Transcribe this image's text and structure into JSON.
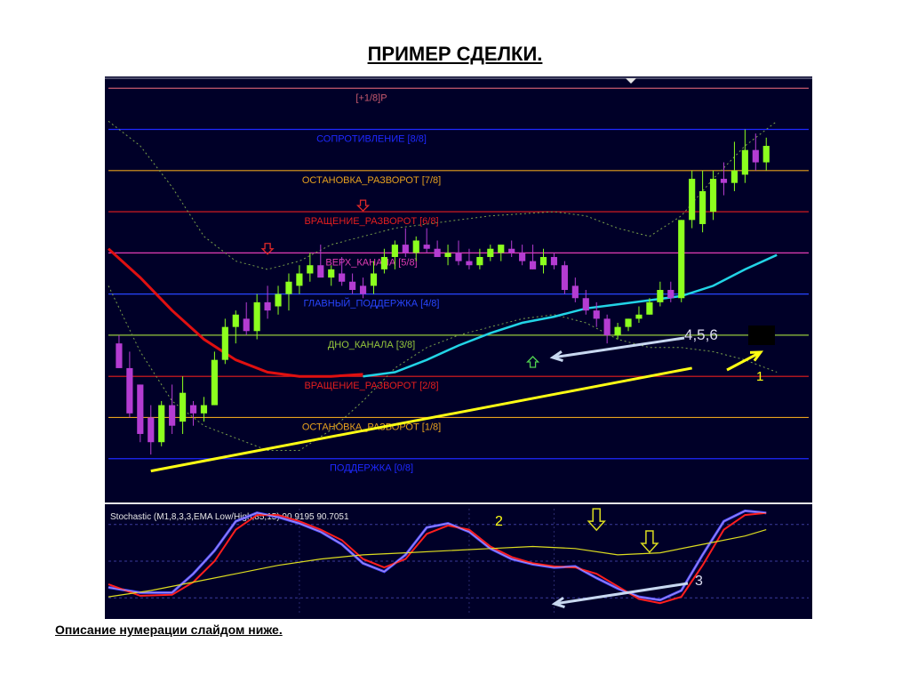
{
  "page": {
    "title": "ПРИМЕР СДЕЛКИ.",
    "footer_note": "Описание нумерации слайдом ниже."
  },
  "colors": {
    "background": "#000028",
    "bull_candle": "#8cff1e",
    "bear_candle": "#b43cd2",
    "ma_slow": "#e01010",
    "ma_fast": "#22d4e6",
    "channel": "#7aa04a",
    "trend_line": "#ffff14",
    "annotation_arrow": "#c8d8f0",
    "stoch_main": "#4a4aff",
    "stoch_signal": "#ff1e1e",
    "stoch_slow": "#dcdc20"
  },
  "chart_data": [
    {
      "type": "candlestick",
      "x": {
        "min": 0,
        "max": 66
      },
      "y": {
        "min": -1.0,
        "max": 9.2
      },
      "levels": [
        {
          "value": 9,
          "label": "[+1/8]P",
          "color": "#c85a6e"
        },
        {
          "value": 8,
          "label": "СОПРОТИВЛЕНИЕ [8/8]",
          "color": "#1e28ff"
        },
        {
          "value": 7,
          "label": "ОСТАНОВКА_РАЗВОРОТ [7/8]",
          "color": "#e6a01e"
        },
        {
          "value": 6,
          "label": "ВРАЩЕНИЕ_РАЗВОРОТ [6/8]",
          "color": "#e61e1e"
        },
        {
          "value": 5,
          "label": "ВЕРХ_КАНАЛА [5/8]",
          "color": "#e23cb4"
        },
        {
          "value": 4,
          "label": "ГЛАВНЫЙ_ПОДДЕРЖКА [4/8]",
          "color": "#2846ff"
        },
        {
          "value": 3,
          "label": "ДНО_КАНАЛА [3/8]",
          "color": "#96c83c"
        },
        {
          "value": 2,
          "label": "ВРАЩЕНИЕ_РАЗВОРОТ [2/8]",
          "color": "#e61e1e"
        },
        {
          "value": 1,
          "label": "ОСТАНОВКА_РАЗВОРОТ [1/8]",
          "color": "#e6a01e"
        },
        {
          "value": 0,
          "label": "ПОДДЕРЖКА [0/8]",
          "color": "#1e28ff"
        }
      ],
      "candles": [
        [
          1,
          2.8,
          3.0,
          2.2,
          2.2
        ],
        [
          2,
          2.2,
          2.6,
          1.0,
          1.1
        ],
        [
          3,
          1.8,
          1.8,
          0.4,
          0.6
        ],
        [
          4,
          1.0,
          1.3,
          0.1,
          0.4
        ],
        [
          5,
          0.4,
          1.4,
          0.3,
          1.3
        ],
        [
          6,
          1.3,
          1.8,
          0.6,
          0.8
        ],
        [
          7,
          0.9,
          2.0,
          0.6,
          1.6
        ],
        [
          8,
          1.3,
          1.4,
          0.8,
          1.1
        ],
        [
          9,
          1.1,
          1.5,
          0.9,
          1.3
        ],
        [
          10,
          1.3,
          2.6,
          1.3,
          2.4
        ],
        [
          11,
          2.4,
          3.4,
          2.3,
          3.2
        ],
        [
          12,
          3.2,
          3.6,
          2.8,
          3.5
        ],
        [
          13,
          3.4,
          3.8,
          3.0,
          3.1
        ],
        [
          14,
          3.1,
          4.0,
          2.9,
          3.8
        ],
        [
          15,
          3.8,
          4.2,
          3.4,
          3.6
        ],
        [
          16,
          3.7,
          4.2,
          3.5,
          4.0
        ],
        [
          17,
          4.0,
          4.5,
          3.6,
          4.3
        ],
        [
          18,
          4.2,
          4.7,
          4.0,
          4.5
        ],
        [
          19,
          4.5,
          5.0,
          4.3,
          4.7
        ],
        [
          20,
          4.7,
          5.2,
          4.5,
          4.4
        ],
        [
          21,
          4.4,
          4.7,
          4.2,
          4.6
        ],
        [
          22,
          4.5,
          4.9,
          4.2,
          4.3
        ],
        [
          23,
          4.3,
          4.5,
          4.0,
          4.1
        ],
        [
          24,
          4.2,
          4.4,
          3.9,
          4.0
        ],
        [
          25,
          4.2,
          4.8,
          4.0,
          4.5
        ],
        [
          26,
          4.6,
          5.1,
          4.5,
          4.9
        ],
        [
          27,
          4.9,
          5.3,
          4.6,
          5.2
        ],
        [
          28,
          5.2,
          5.6,
          4.9,
          5.0
        ],
        [
          29,
          5.0,
          5.4,
          4.8,
          5.3
        ],
        [
          30,
          5.2,
          5.6,
          5.0,
          5.1
        ],
        [
          31,
          5.1,
          5.3,
          4.9,
          4.9
        ],
        [
          32,
          4.9,
          5.2,
          4.7,
          5.0
        ],
        [
          33,
          5.0,
          5.3,
          4.7,
          4.8
        ],
        [
          34,
          4.8,
          5.1,
          4.6,
          4.7
        ],
        [
          35,
          4.7,
          5.1,
          4.6,
          4.9
        ],
        [
          36,
          4.9,
          5.2,
          4.8,
          5.1
        ],
        [
          37,
          5.0,
          5.2,
          4.8,
          5.2
        ],
        [
          38,
          5.1,
          5.3,
          4.9,
          5.0
        ],
        [
          39,
          5.0,
          5.2,
          4.7,
          4.8
        ],
        [
          40,
          4.8,
          5.2,
          4.6,
          4.6
        ],
        [
          41,
          4.7,
          5.1,
          4.5,
          4.9
        ],
        [
          42,
          4.9,
          5.0,
          4.6,
          4.7
        ],
        [
          43,
          4.7,
          4.8,
          4.0,
          4.1
        ],
        [
          44,
          4.2,
          4.4,
          3.8,
          3.9
        ],
        [
          45,
          3.9,
          4.1,
          3.5,
          3.6
        ],
        [
          46,
          3.6,
          3.8,
          3.2,
          3.4
        ],
        [
          47,
          3.4,
          3.5,
          2.8,
          3.0
        ],
        [
          48,
          3.0,
          3.3,
          2.9,
          3.2
        ],
        [
          49,
          3.2,
          3.4,
          3.1,
          3.4
        ],
        [
          50,
          3.4,
          3.7,
          3.3,
          3.5
        ],
        [
          51,
          3.5,
          3.9,
          3.5,
          3.8
        ],
        [
          52,
          3.8,
          4.3,
          3.7,
          4.1
        ],
        [
          53,
          4.1,
          4.3,
          3.8,
          3.9
        ],
        [
          54,
          3.9,
          5.8,
          3.8,
          5.8
        ],
        [
          55,
          5.8,
          7.0,
          5.6,
          6.8
        ],
        [
          56,
          5.7,
          7.0,
          5.5,
          6.5
        ],
        [
          57,
          6.0,
          7.0,
          5.8,
          6.8
        ],
        [
          58,
          6.8,
          7.2,
          6.4,
          6.7
        ],
        [
          59,
          6.7,
          7.7,
          6.5,
          7.0
        ],
        [
          60,
          6.9,
          8.0,
          6.7,
          7.5
        ],
        [
          61,
          7.5,
          7.9,
          7.0,
          7.2
        ],
        [
          62,
          7.2,
          7.8,
          7.0,
          7.6
        ]
      ],
      "ma_slow": [
        [
          0,
          5.1
        ],
        [
          3,
          4.4
        ],
        [
          6,
          3.6
        ],
        [
          9,
          2.9
        ],
        [
          12,
          2.4
        ],
        [
          15,
          2.1
        ],
        [
          18,
          2.0
        ],
        [
          21,
          2.0
        ],
        [
          24,
          2.05
        ]
      ],
      "ma_fast": [
        [
          24,
          2.0
        ],
        [
          27,
          2.1
        ],
        [
          30,
          2.4
        ],
        [
          33,
          2.75
        ],
        [
          36,
          3.05
        ],
        [
          39,
          3.3
        ],
        [
          42,
          3.45
        ],
        [
          45,
          3.65
        ],
        [
          48,
          3.75
        ],
        [
          51,
          3.85
        ],
        [
          54,
          3.95
        ],
        [
          57,
          4.2
        ],
        [
          60,
          4.6
        ],
        [
          63,
          4.95
        ]
      ],
      "channel_upper": [
        [
          0,
          8.2
        ],
        [
          3,
          7.6
        ],
        [
          6,
          6.6
        ],
        [
          9,
          5.4
        ],
        [
          12,
          4.8
        ],
        [
          15,
          4.6
        ],
        [
          18,
          4.8
        ],
        [
          21,
          5.2
        ],
        [
          24,
          5.4
        ],
        [
          27,
          5.6
        ],
        [
          30,
          5.7
        ],
        [
          33,
          5.8
        ],
        [
          36,
          5.9
        ],
        [
          39,
          5.95
        ],
        [
          42,
          6.0
        ],
        [
          45,
          5.9
        ],
        [
          48,
          5.6
        ],
        [
          51,
          5.4
        ],
        [
          54,
          5.9
        ],
        [
          57,
          6.8
        ],
        [
          60,
          7.6
        ],
        [
          63,
          8.2
        ]
      ],
      "channel_lower": [
        [
          0,
          4.2
        ],
        [
          3,
          2.6
        ],
        [
          6,
          1.4
        ],
        [
          9,
          0.8
        ],
        [
          12,
          0.5
        ],
        [
          15,
          0.2
        ],
        [
          18,
          0.2
        ],
        [
          21,
          0.7
        ],
        [
          24,
          1.4
        ],
        [
          27,
          2.2
        ],
        [
          30,
          2.7
        ],
        [
          33,
          3.0
        ],
        [
          36,
          3.2
        ],
        [
          39,
          3.4
        ],
        [
          42,
          3.5
        ],
        [
          45,
          3.3
        ],
        [
          48,
          2.9
        ],
        [
          51,
          2.7
        ],
        [
          54,
          2.7
        ],
        [
          57,
          2.6
        ],
        [
          60,
          2.4
        ],
        [
          63,
          2.1
        ]
      ],
      "trend_line": {
        "from": [
          4,
          -0.3
        ],
        "to": [
          55,
          2.2
        ]
      },
      "signal_arrows": [
        {
          "x": 15,
          "y": 5.1,
          "dir": "down",
          "color": "#e02828"
        },
        {
          "x": 24,
          "y": 6.15,
          "dir": "down",
          "color": "#e02828"
        },
        {
          "x": 40,
          "y": 2.35,
          "dir": "up",
          "color": "#50d250"
        }
      ],
      "annotations": [
        {
          "text": "4,5,6",
          "color": "#dcdcf0"
        },
        {
          "text": "1",
          "color": "#ffff14"
        }
      ]
    },
    {
      "type": "line",
      "title": "Stochastic (M1,8,3,3,EMA Low/High,85,15) 90.9195 90.7051",
      "y": {
        "min": 0,
        "max": 100
      },
      "levels": [
        85,
        50,
        15
      ],
      "series": [
        {
          "values": [
            [
              0,
              25
            ],
            [
              3,
              20
            ],
            [
              6,
              20
            ],
            [
              8,
              38
            ],
            [
              10,
              60
            ],
            [
              12,
              88
            ],
            [
              14,
              96
            ],
            [
              16,
              92
            ],
            [
              18,
              86
            ],
            [
              20,
              78
            ],
            [
              22,
              66
            ],
            [
              24,
              48
            ],
            [
              26,
              40
            ],
            [
              28,
              56
            ],
            [
              30,
              82
            ],
            [
              32,
              86
            ],
            [
              34,
              78
            ],
            [
              36,
              62
            ],
            [
              38,
              52
            ],
            [
              40,
              47
            ],
            [
              42,
              44
            ],
            [
              44,
              45
            ],
            [
              46,
              34
            ],
            [
              48,
              24
            ],
            [
              50,
              16
            ],
            [
              52,
              13
            ],
            [
              54,
              22
            ],
            [
              56,
              56
            ],
            [
              58,
              88
            ],
            [
              60,
              98
            ],
            [
              62,
              96
            ]
          ]
        },
        {
          "values": [
            [
              0,
              28
            ],
            [
              3,
              17
            ],
            [
              6,
              18
            ],
            [
              8,
              30
            ],
            [
              10,
              50
            ],
            [
              12,
              80
            ],
            [
              14,
              94
            ],
            [
              16,
              94
            ],
            [
              18,
              88
            ],
            [
              20,
              80
            ],
            [
              22,
              70
            ],
            [
              24,
              52
            ],
            [
              26,
              44
            ],
            [
              28,
              52
            ],
            [
              30,
              76
            ],
            [
              32,
              84
            ],
            [
              34,
              80
            ],
            [
              36,
              64
            ],
            [
              38,
              54
            ],
            [
              40,
              48
            ],
            [
              42,
              45
            ],
            [
              44,
              44
            ],
            [
              46,
              38
            ],
            [
              48,
              26
            ],
            [
              50,
              14
            ],
            [
              52,
              10
            ],
            [
              54,
              16
            ],
            [
              56,
              46
            ],
            [
              58,
              80
            ],
            [
              60,
              94
            ],
            [
              62,
              96
            ]
          ]
        },
        {
          "values": [
            [
              0,
              16
            ],
            [
              4,
              22
            ],
            [
              8,
              30
            ],
            [
              12,
              38
            ],
            [
              16,
              46
            ],
            [
              20,
              52
            ],
            [
              24,
              56
            ],
            [
              28,
              58
            ],
            [
              32,
              60
            ],
            [
              36,
              62
            ],
            [
              40,
              64
            ],
            [
              44,
              62
            ],
            [
              48,
              56
            ],
            [
              52,
              58
            ],
            [
              56,
              66
            ],
            [
              60,
              74
            ],
            [
              62,
              80
            ]
          ]
        }
      ],
      "signal_arrows": [
        {
          "x": 46,
          "y": 88
        },
        {
          "x": 51,
          "y": 67
        }
      ],
      "annotations": [
        {
          "text": "2",
          "color": "#ffff14"
        },
        {
          "text": "3",
          "color": "#dcdcf0"
        }
      ]
    }
  ]
}
